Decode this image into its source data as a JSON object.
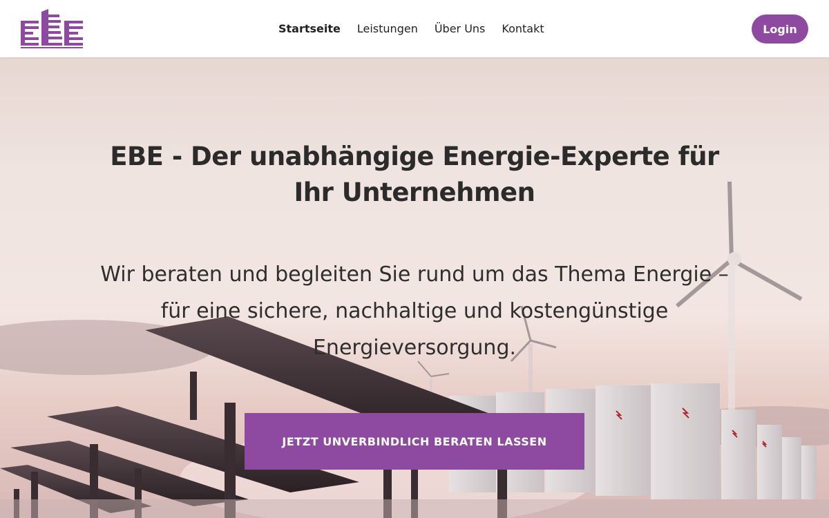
{
  "brand": {
    "logo_text": "EBE",
    "accent": "#8e4aa0"
  },
  "nav": {
    "items": [
      {
        "label": "Startseite",
        "active": true
      },
      {
        "label": "Leistungen"
      },
      {
        "label": "Über Uns"
      },
      {
        "label": "Kontakt"
      }
    ]
  },
  "header": {
    "login_label": "Login"
  },
  "hero": {
    "title": "EBE - Der unabhängige Energie-Experte für Ihr Unternehmen",
    "subtitle": "Wir beraten und begleiten Sie rund um das Thema Energie – für eine sichere, nachhaltige und kostengünstige Energieversorgung.",
    "cta_label": "JETZT UNVERBINDLICH BERATEN LASSEN",
    "background_image": "solar panels, battery storage units and wind turbines at sunset"
  }
}
